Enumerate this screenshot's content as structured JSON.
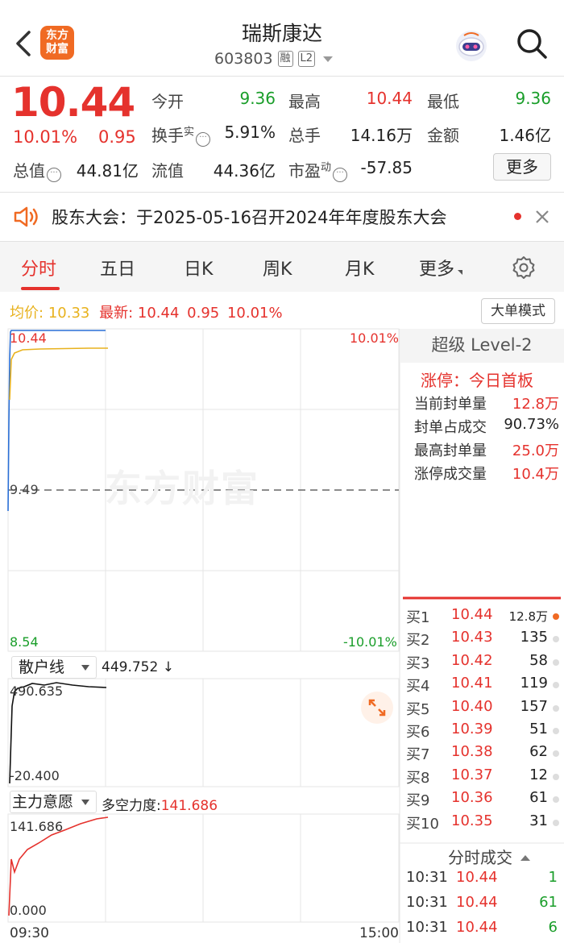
{
  "header": {
    "logo_text_1": "东方",
    "logo_text_2": "财富",
    "title": "瑞斯康达",
    "code": "603803",
    "tag_margin": "融",
    "tag_level": "L2"
  },
  "quote": {
    "price": "10.44",
    "change_pct": "10.01%",
    "change_abs": "0.95",
    "open_label": "今开",
    "open_value": "9.36",
    "high_label": "最高",
    "high_value": "10.44",
    "low_label": "最低",
    "low_value": "9.36",
    "turnover_label": "换手",
    "turnover_sup": "实",
    "turnover_value": "5.91%",
    "volume_label": "总手",
    "volume_value": "14.16万",
    "amount_label": "金额",
    "amount_value": "1.46亿",
    "mktcap_label": "总值",
    "mktcap_value": "44.81亿",
    "float_label": "流值",
    "float_value": "44.36亿",
    "pe_label": "市盈",
    "pe_sup": "动",
    "pe_value": "-57.85",
    "more_button": "更多"
  },
  "notice": {
    "text": "股东大会：于2025-05-16召开2024年年度股东大会"
  },
  "tabs": [
    {
      "label": "分时"
    },
    {
      "label": "五日"
    },
    {
      "label": "日K"
    },
    {
      "label": "周K"
    },
    {
      "label": "月K"
    },
    {
      "label": "更多"
    }
  ],
  "price_line": {
    "avg_label": "均价:",
    "avg_value": "10.33",
    "latest_label": "最新:",
    "latest_value": "10.44",
    "latest_change": "0.95",
    "latest_pct": "10.01%",
    "mode_button": "大单模式"
  },
  "main_chart": {
    "top_left": "10.44",
    "mid_left": "9.49",
    "bottom_left": "8.54",
    "top_right": "10.01%",
    "bottom_right": "-10.01%",
    "watermark": "东方财富"
  },
  "retail_chart": {
    "selector": "散户线",
    "value": "449.752 ↓",
    "top_label": "490.635",
    "bottom_label": "-20.400"
  },
  "main_force_chart": {
    "selector": "主力意愿",
    "strength_label": "多空力度:",
    "strength_value": "141.686",
    "top_label": "141.686",
    "bottom_label": "0.000",
    "time_start": "09:30",
    "time_end": "15:00"
  },
  "level2": {
    "title": "超级 Level-2",
    "limit_label": "涨停：今日首板",
    "rows": [
      {
        "label": "当前封单量",
        "value": "12.8万"
      },
      {
        "label": "封单占成交",
        "value": "90.73%"
      },
      {
        "label": "最高封单量",
        "value": "25.0万"
      },
      {
        "label": "涨停成交量",
        "value": "10.4万"
      }
    ]
  },
  "order_book": [
    {
      "label": "买1",
      "price": "10.44",
      "qty": "12.8万"
    },
    {
      "label": "买2",
      "price": "10.43",
      "qty": "135"
    },
    {
      "label": "买3",
      "price": "10.42",
      "qty": "58"
    },
    {
      "label": "买4",
      "price": "10.41",
      "qty": "119"
    },
    {
      "label": "买5",
      "price": "10.40",
      "qty": "157"
    },
    {
      "label": "买6",
      "price": "10.39",
      "qty": "51"
    },
    {
      "label": "买7",
      "price": "10.38",
      "qty": "62"
    },
    {
      "label": "买8",
      "price": "10.37",
      "qty": "12"
    },
    {
      "label": "买9",
      "price": "10.36",
      "qty": "61"
    },
    {
      "label": "买10",
      "price": "10.35",
      "qty": "31"
    }
  ],
  "trades": {
    "title": "分时成交",
    "rows": [
      {
        "time": "10:31",
        "price": "10.44",
        "vol": "1"
      },
      {
        "time": "10:31",
        "price": "10.44",
        "vol": "61"
      },
      {
        "time": "10:31",
        "price": "10.44",
        "vol": "6"
      }
    ]
  },
  "colors": {
    "up": "#e5322d",
    "down": "#1a9e2a",
    "avg_line": "#e8b21e",
    "price_line": "#2a6fd6",
    "brand": "#f06a23"
  }
}
